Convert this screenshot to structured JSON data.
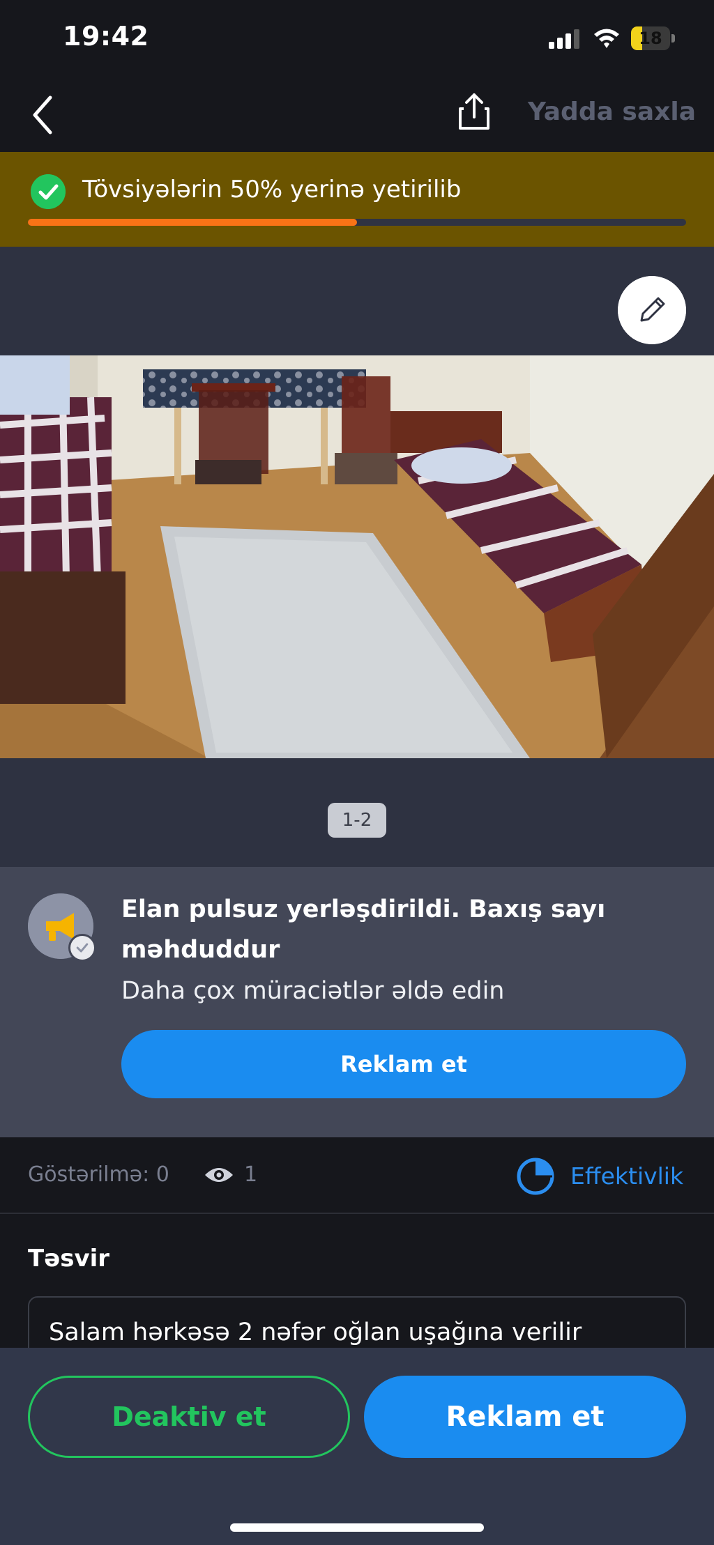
{
  "status_bar": {
    "time": "19:42",
    "battery_level": "18"
  },
  "nav": {
    "save_label": "Yadda saxla",
    "icons": [
      "chevron-left-icon",
      "share-icon"
    ]
  },
  "recommendations": {
    "text": "Tövsiyələrin 50% yerinə yetirilib",
    "progress_percent": 50
  },
  "gallery": {
    "counter": "1-2"
  },
  "promo": {
    "title": "Elan pulsuz yerləşdirildi. Baxış sayı məhduddur",
    "subtitle": "Daha çox müraciətlər əldə edin",
    "button_label": "Reklam et"
  },
  "stats": {
    "impressions": "Göstərilmə: 0",
    "views": "1",
    "effectiveness_label": "Effektivlik"
  },
  "description": {
    "title": "Təsvir",
    "text": "Salam hərkəsə 2 nəfər oğlan uşağına verilir"
  },
  "actions": {
    "deactivate_label": "Deaktiv et",
    "promote_label": "Reklam et"
  },
  "colors": {
    "accent_blue": "#1a8cf0",
    "success_green": "#22c55e",
    "progress_orange": "#f97316",
    "banner_bg": "#6b5400"
  }
}
